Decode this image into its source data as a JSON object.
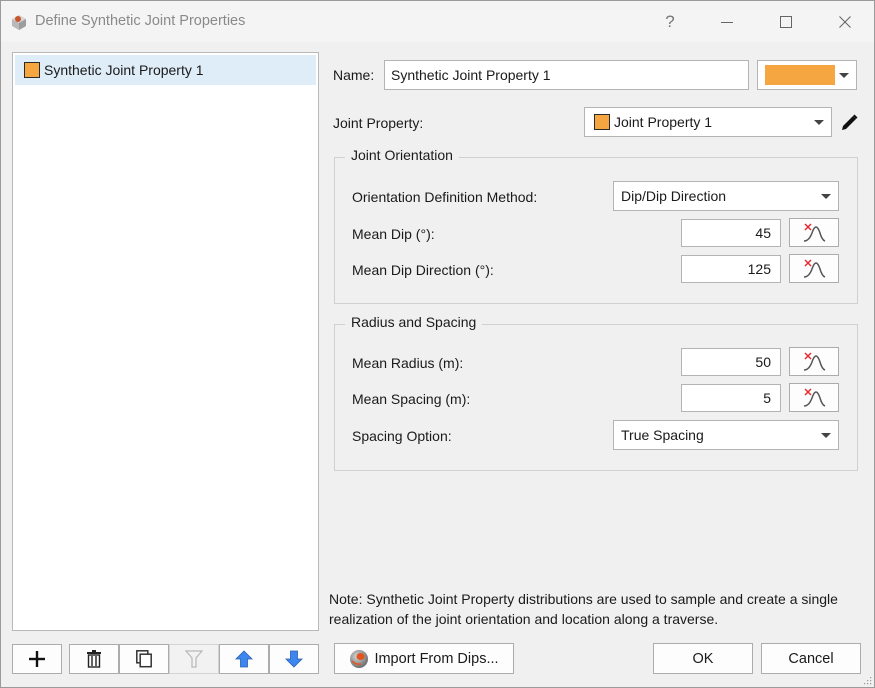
{
  "window": {
    "title": "Define Synthetic Joint Properties",
    "help_label": "?",
    "minimize_label": "—",
    "close_label": "✕"
  },
  "list": {
    "items": [
      {
        "label": "Synthetic Joint Property 1",
        "color": "#f5a641",
        "selected": true
      }
    ]
  },
  "list_toolbar": {
    "add_icon": "plus-icon",
    "delete_icon": "trash-icon",
    "copy_icon": "copy-icon",
    "filter_icon": "filter-icon",
    "move_up_icon": "arrow-up-icon",
    "move_down_icon": "arrow-down-icon"
  },
  "form": {
    "name_label": "Name:",
    "name_value": "Synthetic Joint Property 1",
    "color_value": "#f5a641",
    "joint_property_label": "Joint Property:",
    "joint_property_value": "Joint Property 1",
    "joint_property_color": "#f5a641"
  },
  "orientation": {
    "title": "Joint Orientation",
    "method_label": "Orientation Definition Method:",
    "method_value": "Dip/Dip Direction",
    "mean_dip_label": "Mean Dip (°):",
    "mean_dip_value": "45",
    "mean_dip_direction_label": "Mean Dip Direction (°):",
    "mean_dip_direction_value": "125"
  },
  "radius_spacing": {
    "title": "Radius and Spacing",
    "mean_radius_label": "Mean Radius (m):",
    "mean_radius_value": "50",
    "mean_spacing_label": "Mean Spacing (m):",
    "mean_spacing_value": "5",
    "spacing_option_label": "Spacing Option:",
    "spacing_option_value": "True Spacing"
  },
  "note": "Note: Synthetic Joint Property distributions are used to sample and create a single realization of the joint orientation and location along a traverse.",
  "buttons": {
    "import_label": "Import From Dips...",
    "ok_label": "OK",
    "cancel_label": "Cancel"
  },
  "colors": {
    "accent_orange": "#f5a641",
    "selection_bg": "#dfedf8",
    "arrow_blue": "#3d86ef"
  }
}
